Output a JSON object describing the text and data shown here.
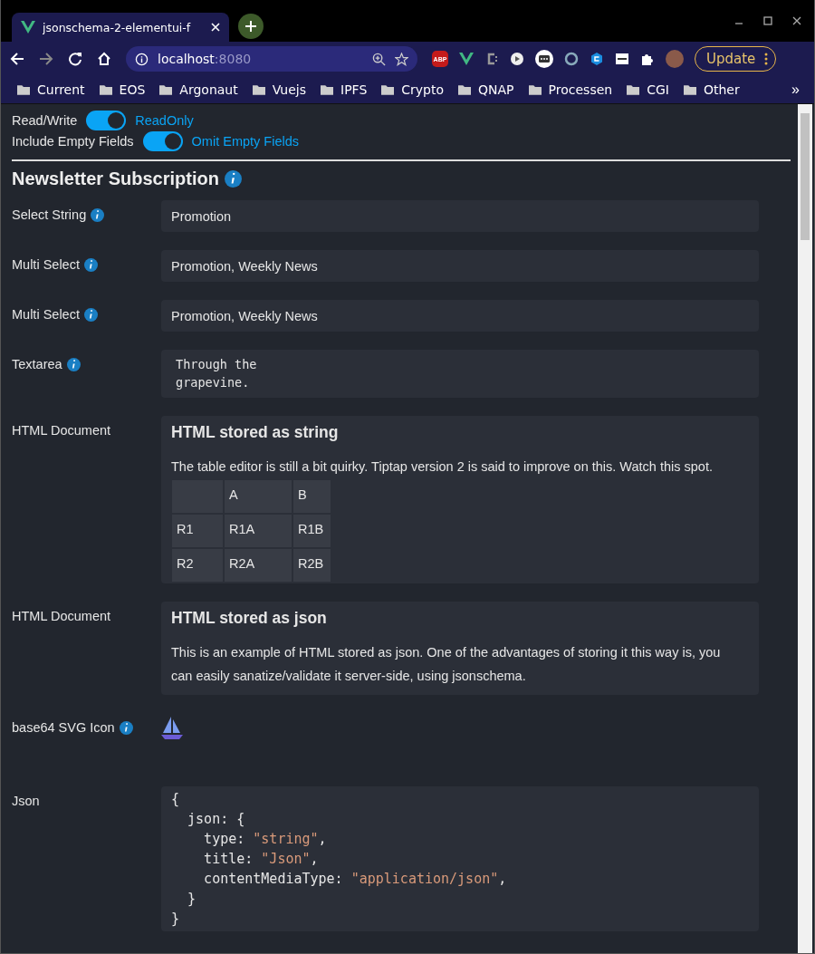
{
  "browser": {
    "tab_title": "jsonschema-2-elementui-f",
    "url_host": "localhost",
    "url_port": ":8080",
    "abp_badge": "ABP",
    "update_button": "Update",
    "bookmarks": [
      "Current",
      "EOS",
      "Argonaut",
      "Vuejs",
      "IPFS",
      "Crypto",
      "QNAP",
      "Processen",
      "CGI",
      "Other"
    ],
    "bookmarks_more": "»"
  },
  "toggles": [
    {
      "label_off": "Read/Write",
      "on": true,
      "label_on": "ReadOnly"
    },
    {
      "label_off": "Include Empty Fields",
      "on": true,
      "label_on": "Omit Empty Fields"
    }
  ],
  "form": {
    "title": "Newsletter Subscription",
    "info": true,
    "fields": [
      {
        "kind": "input",
        "label": "Select String",
        "info": true,
        "value": "Promotion"
      },
      {
        "kind": "input",
        "label": "Multi Select",
        "info": true,
        "value": "Promotion, Weekly News"
      },
      {
        "kind": "input",
        "label": "Multi Select",
        "info": true,
        "value": "Promotion, Weekly News"
      },
      {
        "kind": "textarea",
        "label": "Textarea",
        "info": true,
        "value": "Through the\ngrapevine."
      },
      {
        "kind": "html",
        "label": "HTML Document",
        "info": false,
        "heading": "HTML stored as string",
        "paragraph": "The table editor is still a bit quirky. Tiptap version 2 is said to improve on this. Watch this spot.",
        "table": {
          "columns": [
            "A",
            "B"
          ],
          "rows": [
            {
              "header": "R1",
              "cells": [
                "R1A",
                "R1B"
              ]
            },
            {
              "header": "R2",
              "cells": [
                "R2A",
                "R2B"
              ]
            }
          ]
        }
      },
      {
        "kind": "html",
        "label": "HTML Document",
        "info": false,
        "heading": "HTML stored as json",
        "paragraph": "This is an example of HTML stored as json. One of the advantages of storing it this way is, you can easily sanatize/validate it server-side, using jsonschema."
      },
      {
        "kind": "icon",
        "label": "base64 SVG Icon",
        "info": true
      },
      {
        "kind": "code",
        "label": "Json",
        "info": false,
        "lines": [
          [
            {
              "kind": "plain",
              "text": "{"
            }
          ],
          [
            {
              "kind": "plain",
              "text": "  json: {"
            }
          ],
          [
            {
              "kind": "plain",
              "text": "    type: "
            },
            {
              "kind": "string",
              "text": "\"string\""
            },
            {
              "kind": "plain",
              "text": ","
            }
          ],
          [
            {
              "kind": "plain",
              "text": "    title: "
            },
            {
              "kind": "string",
              "text": "\"Json\""
            },
            {
              "kind": "plain",
              "text": ","
            }
          ],
          [
            {
              "kind": "plain",
              "text": "    contentMediaType: "
            },
            {
              "kind": "string",
              "text": "\"application/json\""
            },
            {
              "kind": "plain",
              "text": ","
            }
          ],
          [
            {
              "kind": "plain",
              "text": "  }"
            }
          ],
          [
            {
              "kind": "plain",
              "text": "}"
            }
          ]
        ]
      }
    ]
  }
}
